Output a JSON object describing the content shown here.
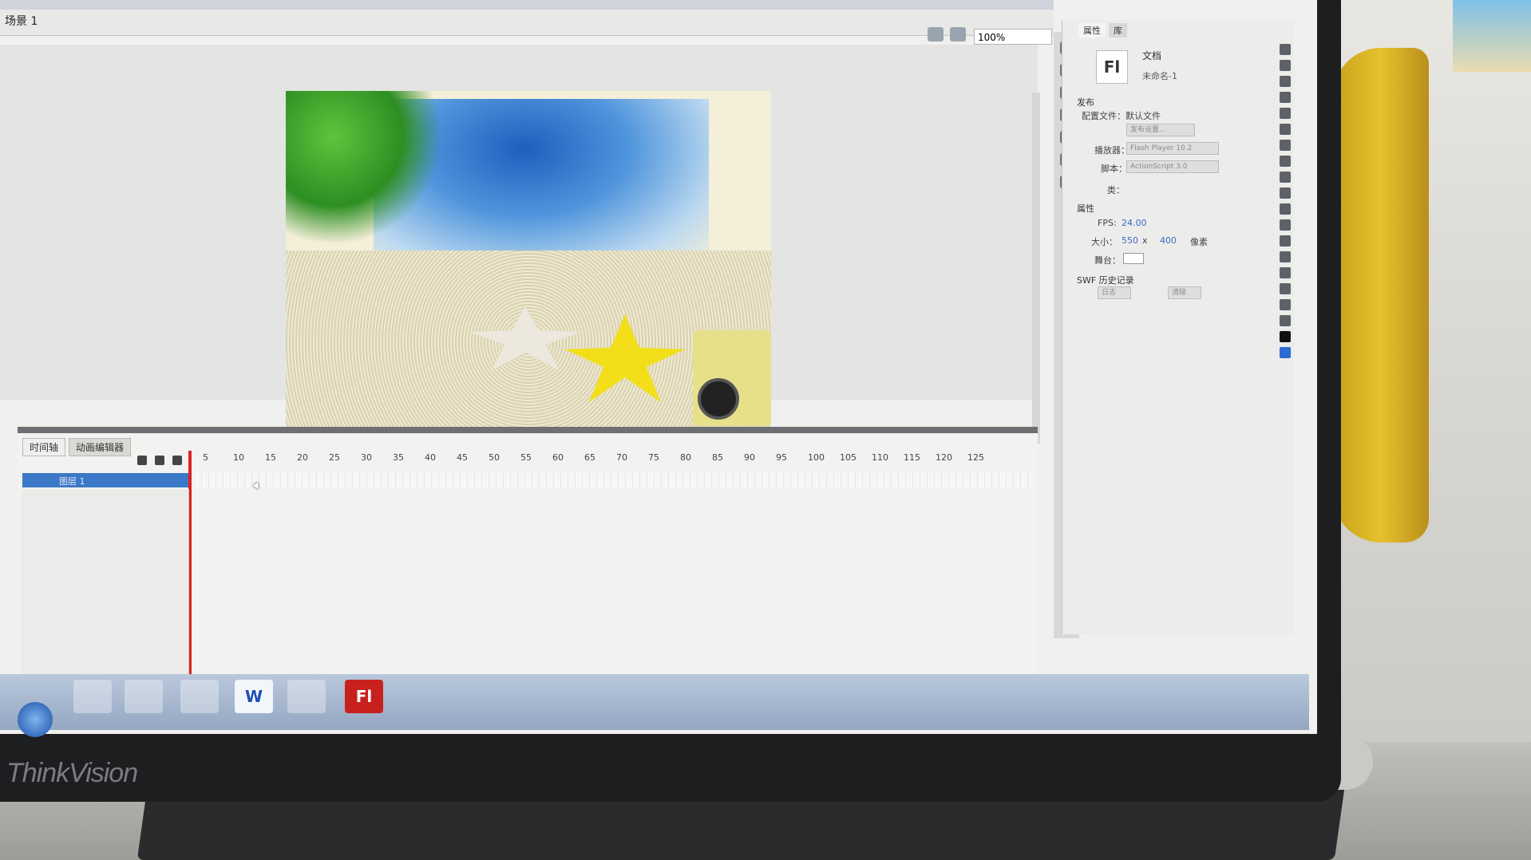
{
  "scene": {
    "label": "场景 1",
    "zoom": "100%"
  },
  "timeline": {
    "tabs": [
      "时间轴",
      "动画编辑器"
    ],
    "ruler": [
      "5",
      "10",
      "15",
      "20",
      "25",
      "30",
      "35",
      "40",
      "45",
      "50",
      "55",
      "60",
      "65",
      "70",
      "75",
      "80",
      "85",
      "90",
      "95",
      "100",
      "105",
      "110",
      "115",
      "120",
      "125"
    ],
    "layer_name": "图层 1"
  },
  "properties": {
    "tabs": [
      "属性",
      "库"
    ],
    "badge": "Fl",
    "doc_title": "文档",
    "doc_name": "未命名-1",
    "publish_section": "发布",
    "profile_label": "配置文件：默认文件",
    "publish_settings_button": "发布设置...",
    "player_label": "播放器：",
    "player_value": "Flash Player 10.2",
    "script_label": "脚本：",
    "script_value": "ActionScript 3.0",
    "class_label": "类：",
    "props_section": "属性",
    "fps_label": "FPS:",
    "fps_value": "24.00",
    "size_label": "大小：",
    "size_w": "550",
    "size_x": "x",
    "size_h": "400",
    "size_unit": "像素",
    "stage_label": "舞台：",
    "stage_color": "#ffffff",
    "swf_section": "SWF 历史记录",
    "log_button": "日志",
    "clear_button": "清除"
  },
  "taskbar": {
    "word": "W",
    "flash": "Fl"
  },
  "brand": "ThinkVision"
}
